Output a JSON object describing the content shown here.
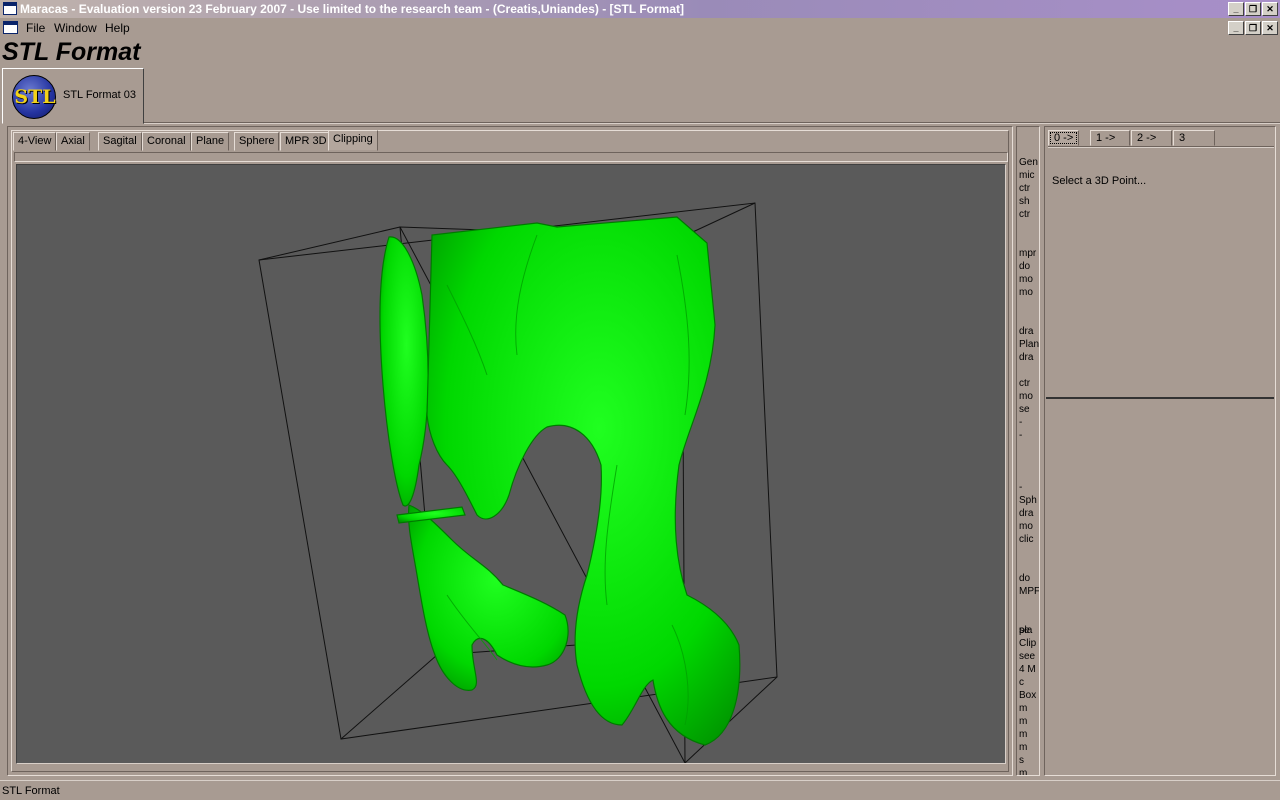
{
  "window": {
    "title": "Maracas - Evaluation version 23 February 2007 - Use limited to the research team - (Creatis,Uniandes) - [STL Format]"
  },
  "menu": {
    "items": [
      "File",
      "Window",
      "Help"
    ]
  },
  "app": {
    "heading": "STL Format"
  },
  "module_tab": {
    "logo_text": "STL",
    "label": "STL Format 03"
  },
  "view_tabs": [
    "4-View",
    "Axial",
    "Sagital",
    "Coronal",
    "Plane",
    "Sphere",
    "MPR 3D",
    "Clipping"
  ],
  "active_view_tab": "Clipping",
  "help_strip": {
    "lines": [
      "Gen",
      "mic",
      "ctr",
      "sh",
      "ctr",
      "mpr",
      "do",
      "mo",
      "mo",
      "dra",
      "Plan",
      "dra",
      "ctr",
      "mo",
      "se",
      "-",
      "-",
      "-",
      "Sph",
      "dra",
      "mo",
      "clic",
      "do",
      "MPF",
      "se",
      "Clip",
      "see",
      "4 M",
      "c",
      "Box",
      "m",
      "m",
      "m",
      "m",
      "s",
      "m",
      "pla"
    ]
  },
  "point_tabs": [
    "0 ->",
    "1 ->",
    "2 ->",
    "3"
  ],
  "point_panel": {
    "instruction": "Select a 3D Point..."
  },
  "status": {
    "text": "STL Format"
  },
  "colors": {
    "mesh": "#00e000",
    "viewport_bg": "#5a5a5a",
    "panel_bg": "#a89b92"
  }
}
